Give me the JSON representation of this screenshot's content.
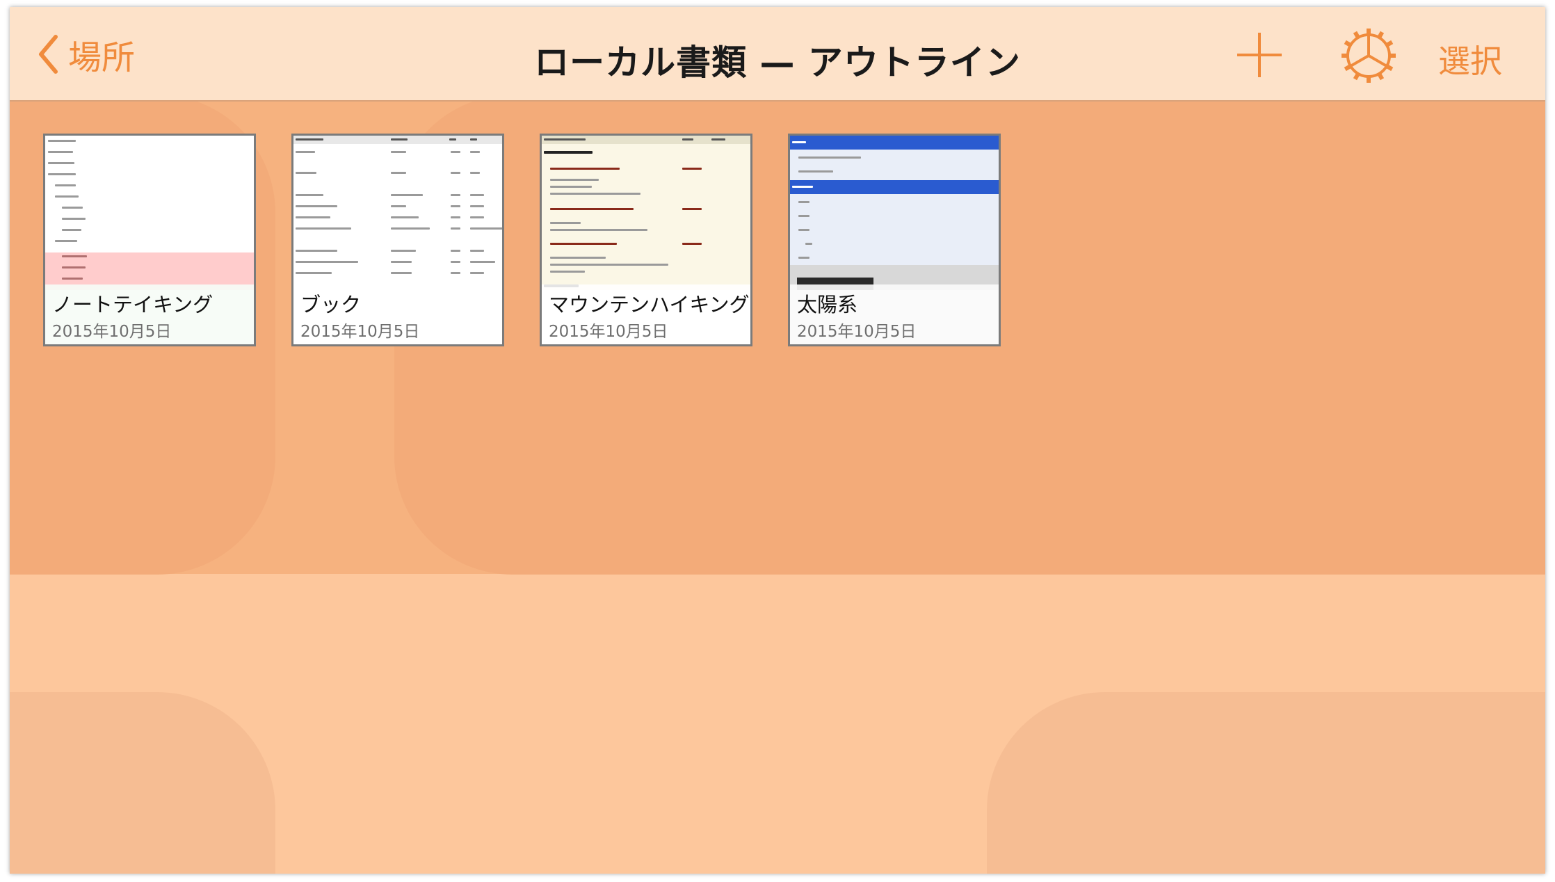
{
  "nav": {
    "back_label": "場所",
    "title": "ローカル書類 — アウトライン",
    "select_label": "選択"
  },
  "icons": {
    "back": "chevron-left-icon",
    "add": "plus-icon",
    "settings": "gear-icon"
  },
  "colors": {
    "accent": "#f08b3c",
    "navbar_bg": "#fde2c9",
    "page_bg": "#f6b27f"
  },
  "documents": [
    {
      "name": "ノートテイキング",
      "date": "2015年10月5日"
    },
    {
      "name": "ブック",
      "date": "2015年10月5日"
    },
    {
      "name": "マウンテンハイキング",
      "date": "2015年10月5日"
    },
    {
      "name": "太陽系",
      "date": "2015年10月5日"
    }
  ]
}
